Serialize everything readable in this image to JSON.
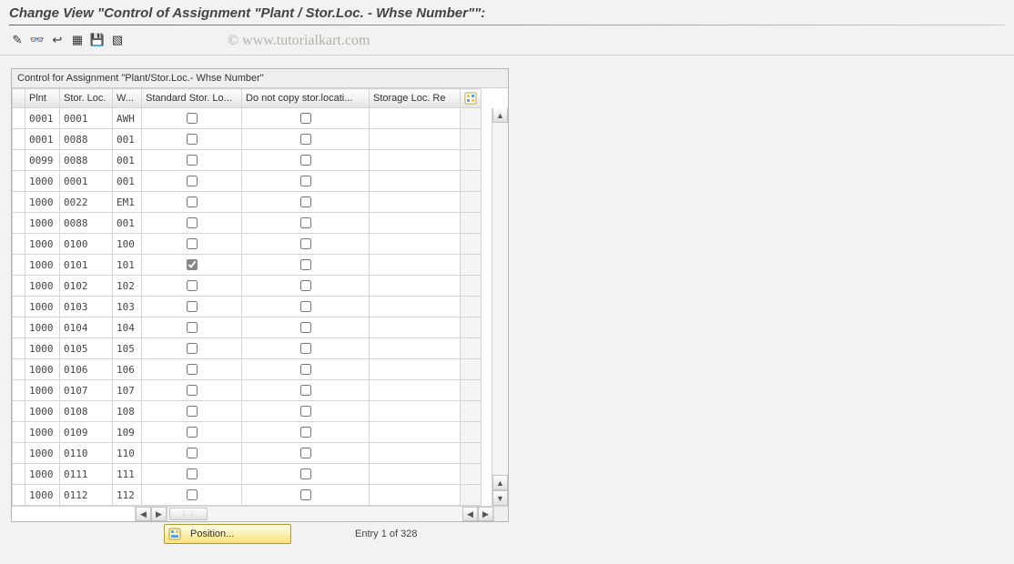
{
  "header": {
    "title": "Change View \"Control of Assignment \"Plant / Stor.Loc. - Whse Number\"\":"
  },
  "watermark": "© www.tutorialkart.com",
  "toolbar": {
    "icons": [
      {
        "name": "other-view-icon",
        "glyph": "✎"
      },
      {
        "name": "glasses-icon",
        "glyph": "👓"
      },
      {
        "name": "undo-icon",
        "glyph": "↩"
      },
      {
        "name": "select-all-icon",
        "glyph": "▦"
      },
      {
        "name": "save-icon",
        "glyph": "💾"
      },
      {
        "name": "deselect-icon",
        "glyph": "▧"
      }
    ]
  },
  "panel": {
    "title": "Control for Assignment \"Plant/Stor.Loc.- Whse Number\""
  },
  "columns": {
    "plnt": "Plnt",
    "stor": "Stor. Loc.",
    "whs": "W...",
    "std": "Standard Stor. Lo...",
    "nocopy": "Do not copy stor.locati...",
    "re": "Storage Loc. Re"
  },
  "rows": [
    {
      "plnt": "0001",
      "stor": "0001",
      "whs": "AWH",
      "std": false,
      "nocopy": false
    },
    {
      "plnt": "0001",
      "stor": "0088",
      "whs": "001",
      "std": false,
      "nocopy": false
    },
    {
      "plnt": "0099",
      "stor": "0088",
      "whs": "001",
      "std": false,
      "nocopy": false
    },
    {
      "plnt": "1000",
      "stor": "0001",
      "whs": "001",
      "std": false,
      "nocopy": false
    },
    {
      "plnt": "1000",
      "stor": "0022",
      "whs": "EM1",
      "std": false,
      "nocopy": false
    },
    {
      "plnt": "1000",
      "stor": "0088",
      "whs": "001",
      "std": false,
      "nocopy": false
    },
    {
      "plnt": "1000",
      "stor": "0100",
      "whs": "100",
      "std": false,
      "nocopy": false
    },
    {
      "plnt": "1000",
      "stor": "0101",
      "whs": "101",
      "std": true,
      "nocopy": false
    },
    {
      "plnt": "1000",
      "stor": "0102",
      "whs": "102",
      "std": false,
      "nocopy": false
    },
    {
      "plnt": "1000",
      "stor": "0103",
      "whs": "103",
      "std": false,
      "nocopy": false
    },
    {
      "plnt": "1000",
      "stor": "0104",
      "whs": "104",
      "std": false,
      "nocopy": false
    },
    {
      "plnt": "1000",
      "stor": "0105",
      "whs": "105",
      "std": false,
      "nocopy": false
    },
    {
      "plnt": "1000",
      "stor": "0106",
      "whs": "106",
      "std": false,
      "nocopy": false
    },
    {
      "plnt": "1000",
      "stor": "0107",
      "whs": "107",
      "std": false,
      "nocopy": false
    },
    {
      "plnt": "1000",
      "stor": "0108",
      "whs": "108",
      "std": false,
      "nocopy": false
    },
    {
      "plnt": "1000",
      "stor": "0109",
      "whs": "109",
      "std": false,
      "nocopy": false
    },
    {
      "plnt": "1000",
      "stor": "0110",
      "whs": "110",
      "std": false,
      "nocopy": false
    },
    {
      "plnt": "1000",
      "stor": "0111",
      "whs": "111",
      "std": false,
      "nocopy": false
    },
    {
      "plnt": "1000",
      "stor": "0112",
      "whs": "112",
      "std": false,
      "nocopy": false
    }
  ],
  "footer": {
    "position_label": "Position...",
    "entry_label": "Entry 1 of 328"
  }
}
